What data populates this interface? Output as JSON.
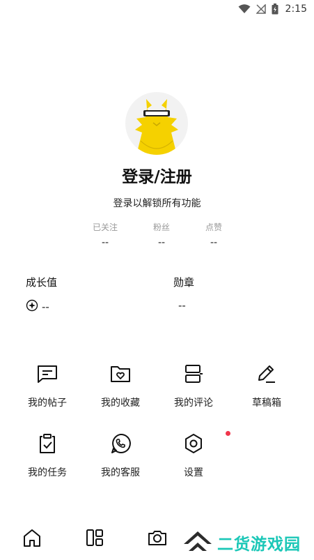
{
  "status_bar": {
    "time": "2:15"
  },
  "profile": {
    "login_title": "登录/注册",
    "login_subtitle": "登录以解锁所有功能"
  },
  "stats": [
    {
      "label": "已关注",
      "value": "--"
    },
    {
      "label": "粉丝",
      "value": "--"
    },
    {
      "label": "点赞",
      "value": "--"
    }
  ],
  "growth": {
    "label": "成长值",
    "value": "--"
  },
  "badge": {
    "label": "勋章",
    "value": "--"
  },
  "menu": [
    {
      "label": "我的帖子",
      "icon": "post-icon"
    },
    {
      "label": "我的收藏",
      "icon": "favorite-folder-icon"
    },
    {
      "label": "我的评论",
      "icon": "comment-icon"
    },
    {
      "label": "草稿箱",
      "icon": "pencil-icon"
    },
    {
      "label": "我的任务",
      "icon": "task-clipboard-icon"
    },
    {
      "label": "我的客服",
      "icon": "customer-service-phone-icon"
    },
    {
      "label": "设置",
      "icon": "settings-hexagon-icon",
      "has_notification_dot": true
    }
  ],
  "tabbar": [
    {
      "icon": "home-icon"
    },
    {
      "icon": "discover-grid-icon"
    },
    {
      "icon": "camera-icon"
    }
  ],
  "watermark": {
    "text": "二货游戏园"
  },
  "colors": {
    "accent_dot": "#f0354b",
    "watermark": "#1bc7b7",
    "avatar_yellow": "#f5d100"
  }
}
